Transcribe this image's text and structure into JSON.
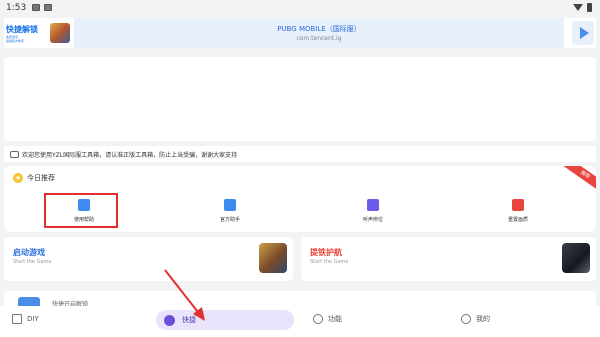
{
  "status_bar": {
    "time": "1:53"
  },
  "top_banner": {
    "brand_title": "快捷解锁",
    "brand_sub_1": "免费激活",
    "brand_sub_2": "提供官方助手",
    "game_name": "PUBG MOBILE（国际服）",
    "game_domain": "com.tencent.ig"
  },
  "notice": {
    "text": "欢迎您使用YZL国际服工具箱，请认准正版工具箱，防止上当受骗，谢谢大家支持"
  },
  "recommend": {
    "title": "今日推荐",
    "ribbon": "推荐",
    "items": [
      {
        "label": "使用帮助",
        "icon": "help-doc-icon",
        "color": "#3d8bf0"
      },
      {
        "label": "官方助手",
        "icon": "video-play-icon",
        "color": "#3d8bf0"
      },
      {
        "label": "听声辨位",
        "icon": "monitor-icon",
        "color": "#6a5ce8"
      },
      {
        "label": "重置画质",
        "icon": "trash-icon",
        "color": "#e8453c"
      }
    ]
  },
  "cards": [
    {
      "title": "启动游戏",
      "subtitle": "Start the Game",
      "color": "#2f6fe0"
    },
    {
      "title": "提铁护航",
      "subtitle": "Start the Game",
      "color": "#e8453c"
    }
  ],
  "partial_card": {
    "text": "快捷开启解锁"
  },
  "bottom_nav": {
    "diy": "DIY",
    "quick": "快捷",
    "features": "功能",
    "mine": "我的"
  }
}
